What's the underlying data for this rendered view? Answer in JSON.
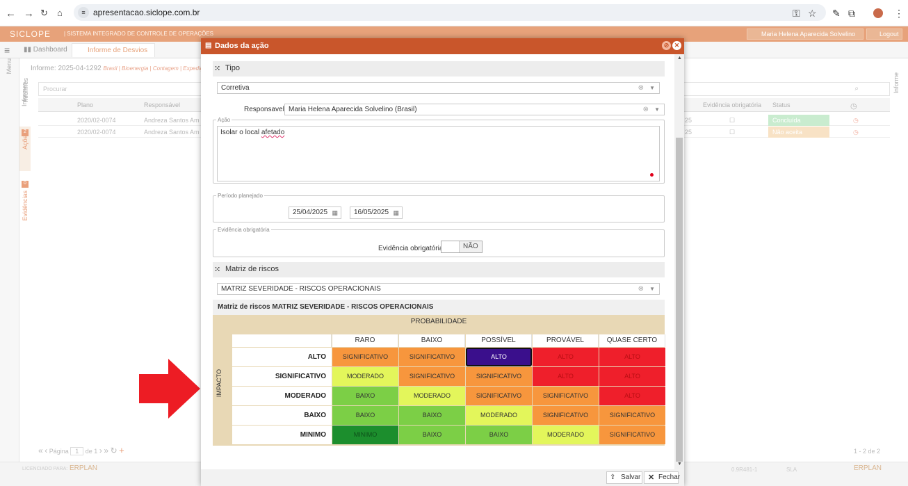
{
  "browser": {
    "url": "apresentacao.siclope.com.br"
  },
  "app": {
    "logo": "SICLOPE",
    "subtitle": "| SISTEMA INTEGRADO DE CONTROLE DE OPERAÇÕES",
    "user": "Maria Helena Aparecida Solvelino",
    "logout": "Logout"
  },
  "tabs": {
    "dashboard": "Dashboard",
    "informe": "Informe de Desvios"
  },
  "left_menu": {
    "menu": "Menu",
    "informes": "Informes",
    "acoes": "Ações",
    "acoes_count": "2",
    "evidencias": "Evidências",
    "evidencias_count": "0",
    "right": "Informe"
  },
  "informe": {
    "title": "Informe: 2025-04-1292",
    "sub": "Brasil | Bioenergia | Contagem | Expedição"
  },
  "grid": {
    "search_placeholder": "Procurar",
    "headers": {
      "plano": "Plano",
      "responsavel": "Responsável",
      "evidencia": "Evidência obrigatória",
      "status": "Status"
    },
    "rows": [
      {
        "plano": "2020/02-0074",
        "responsavel": "Andreza Santos Am",
        "date": "25",
        "status": "Concluída",
        "status_color": "#b8e6c2"
      },
      {
        "plano": "2020/02-0074",
        "responsavel": "Andreza Santos Am",
        "date": "25",
        "status": "Não aceita",
        "status_color": "#f6d3a7"
      }
    ],
    "pager": "Página",
    "pager_page": "1",
    "pager_of": "de 1",
    "count": "1 - 2 de 2"
  },
  "footer": {
    "licensed": "LICENCIADO PARA:",
    "brand": "ERPLAN",
    "version": "0.9R481-1",
    "sla": "SLA"
  },
  "modal": {
    "title": "Dados da ação",
    "tipo_section": "Tipo",
    "tipo_value": "Corretiva",
    "responsavel_label": "Responsavel:*",
    "responsavel_value": "Maria Helena Aparecida Solvelino (Brasil)",
    "acao_legend": "Ação",
    "acao_text_prefix": "Isolar o local ",
    "acao_text_underlined": "afetado",
    "periodo_legend": "Período planejado",
    "date_start": "25/04/2025",
    "date_end": "16/05/2025",
    "evidencia_legend": "Evidência obrigatória",
    "evidencia_label": "Evidência obrigatória",
    "evidencia_toggle": "NÃO",
    "matriz_section": "Matriz de riscos",
    "matriz_value": "MATRIZ SEVERIDADE - RISCOS OPERACIONAIS",
    "matriz_heading": "Matriz de riscos MATRIZ SEVERIDADE - RISCOS OPERACIONAIS",
    "save": "Salvar",
    "close": "Fechar"
  },
  "matrix": {
    "prob_label": "PROBABILIDADE",
    "impact_label": "IMPACTO",
    "columns": [
      "RARO",
      "BAIXO",
      "POSSÍVEL",
      "PROVÁVEL",
      "QUASE CERTO"
    ],
    "rows": [
      {
        "label": "ALTO",
        "cells": [
          "SIGNIFICATIVO",
          "SIGNIFICATIVO",
          "ALTO",
          "ALTO",
          "ALTO"
        ]
      },
      {
        "label": "SIGNIFICATIVO",
        "cells": [
          "MODERADO",
          "SIGNIFICATIVO",
          "SIGNIFICATIVO",
          "ALTO",
          "ALTO"
        ]
      },
      {
        "label": "MODERADO",
        "cells": [
          "BAIXO",
          "MODERADO",
          "SIGNIFICATIVO",
          "SIGNIFICATIVO",
          "ALTO"
        ]
      },
      {
        "label": "BAIXO",
        "cells": [
          "BAIXO",
          "BAIXO",
          "MODERADO",
          "SIGNIFICATIVO",
          "SIGNIFICATIVO"
        ]
      },
      {
        "label": "MINIMO",
        "cells": [
          "MINIMO",
          "BAIXO",
          "BAIXO",
          "MODERADO",
          "SIGNIFICATIVO"
        ]
      }
    ],
    "selected": {
      "row": 0,
      "col": 2
    },
    "colors": {
      "ALTO": "#ef1f2b",
      "SIGNIFICATIVO": "#f7963d",
      "MODERADO": "#e3f65b",
      "BAIXO": "#7ccf46",
      "MINIMO": "#1c8e2d",
      "selected": "#3a0f8c"
    }
  }
}
